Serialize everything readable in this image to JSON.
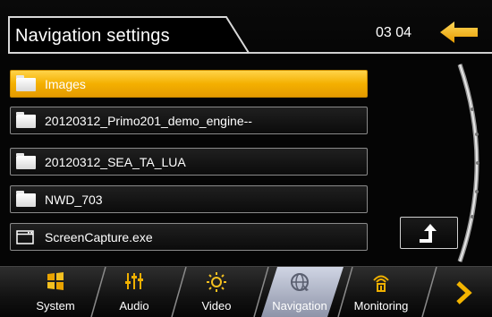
{
  "header": {
    "title": "Navigation settings",
    "page_indicator": "03 04",
    "back_icon": "back-arrow-icon"
  },
  "files": [
    {
      "label": "Images",
      "type": "folder",
      "selected": true
    },
    {
      "label": "20120312_Primo201_demo_engine--",
      "type": "folder",
      "selected": false
    },
    {
      "label": "20120312_SEA_TA_LUA",
      "type": "folder",
      "selected": false
    },
    {
      "label": "NWD_703",
      "type": "folder",
      "selected": false
    },
    {
      "label": "ScreenCapture.exe",
      "type": "file",
      "selected": false
    }
  ],
  "up_button_icon": "up-level-arrow-icon",
  "bottom_tabs": [
    {
      "label": "System",
      "icon": "system-windows-icon",
      "active": false
    },
    {
      "label": "Audio",
      "icon": "equalizer-icon",
      "active": false
    },
    {
      "label": "Video",
      "icon": "brightness-icon",
      "active": false
    },
    {
      "label": "Navigation",
      "icon": "globe-icon",
      "active": true
    },
    {
      "label": "Monitoring",
      "icon": "monitoring-icon",
      "active": false
    }
  ],
  "next_icon": "chevron-right-icon",
  "colors": {
    "accent": "#f5b400",
    "selected_row": "#f4b000",
    "background": "#000000",
    "active_tab": "#aeb4c8"
  }
}
